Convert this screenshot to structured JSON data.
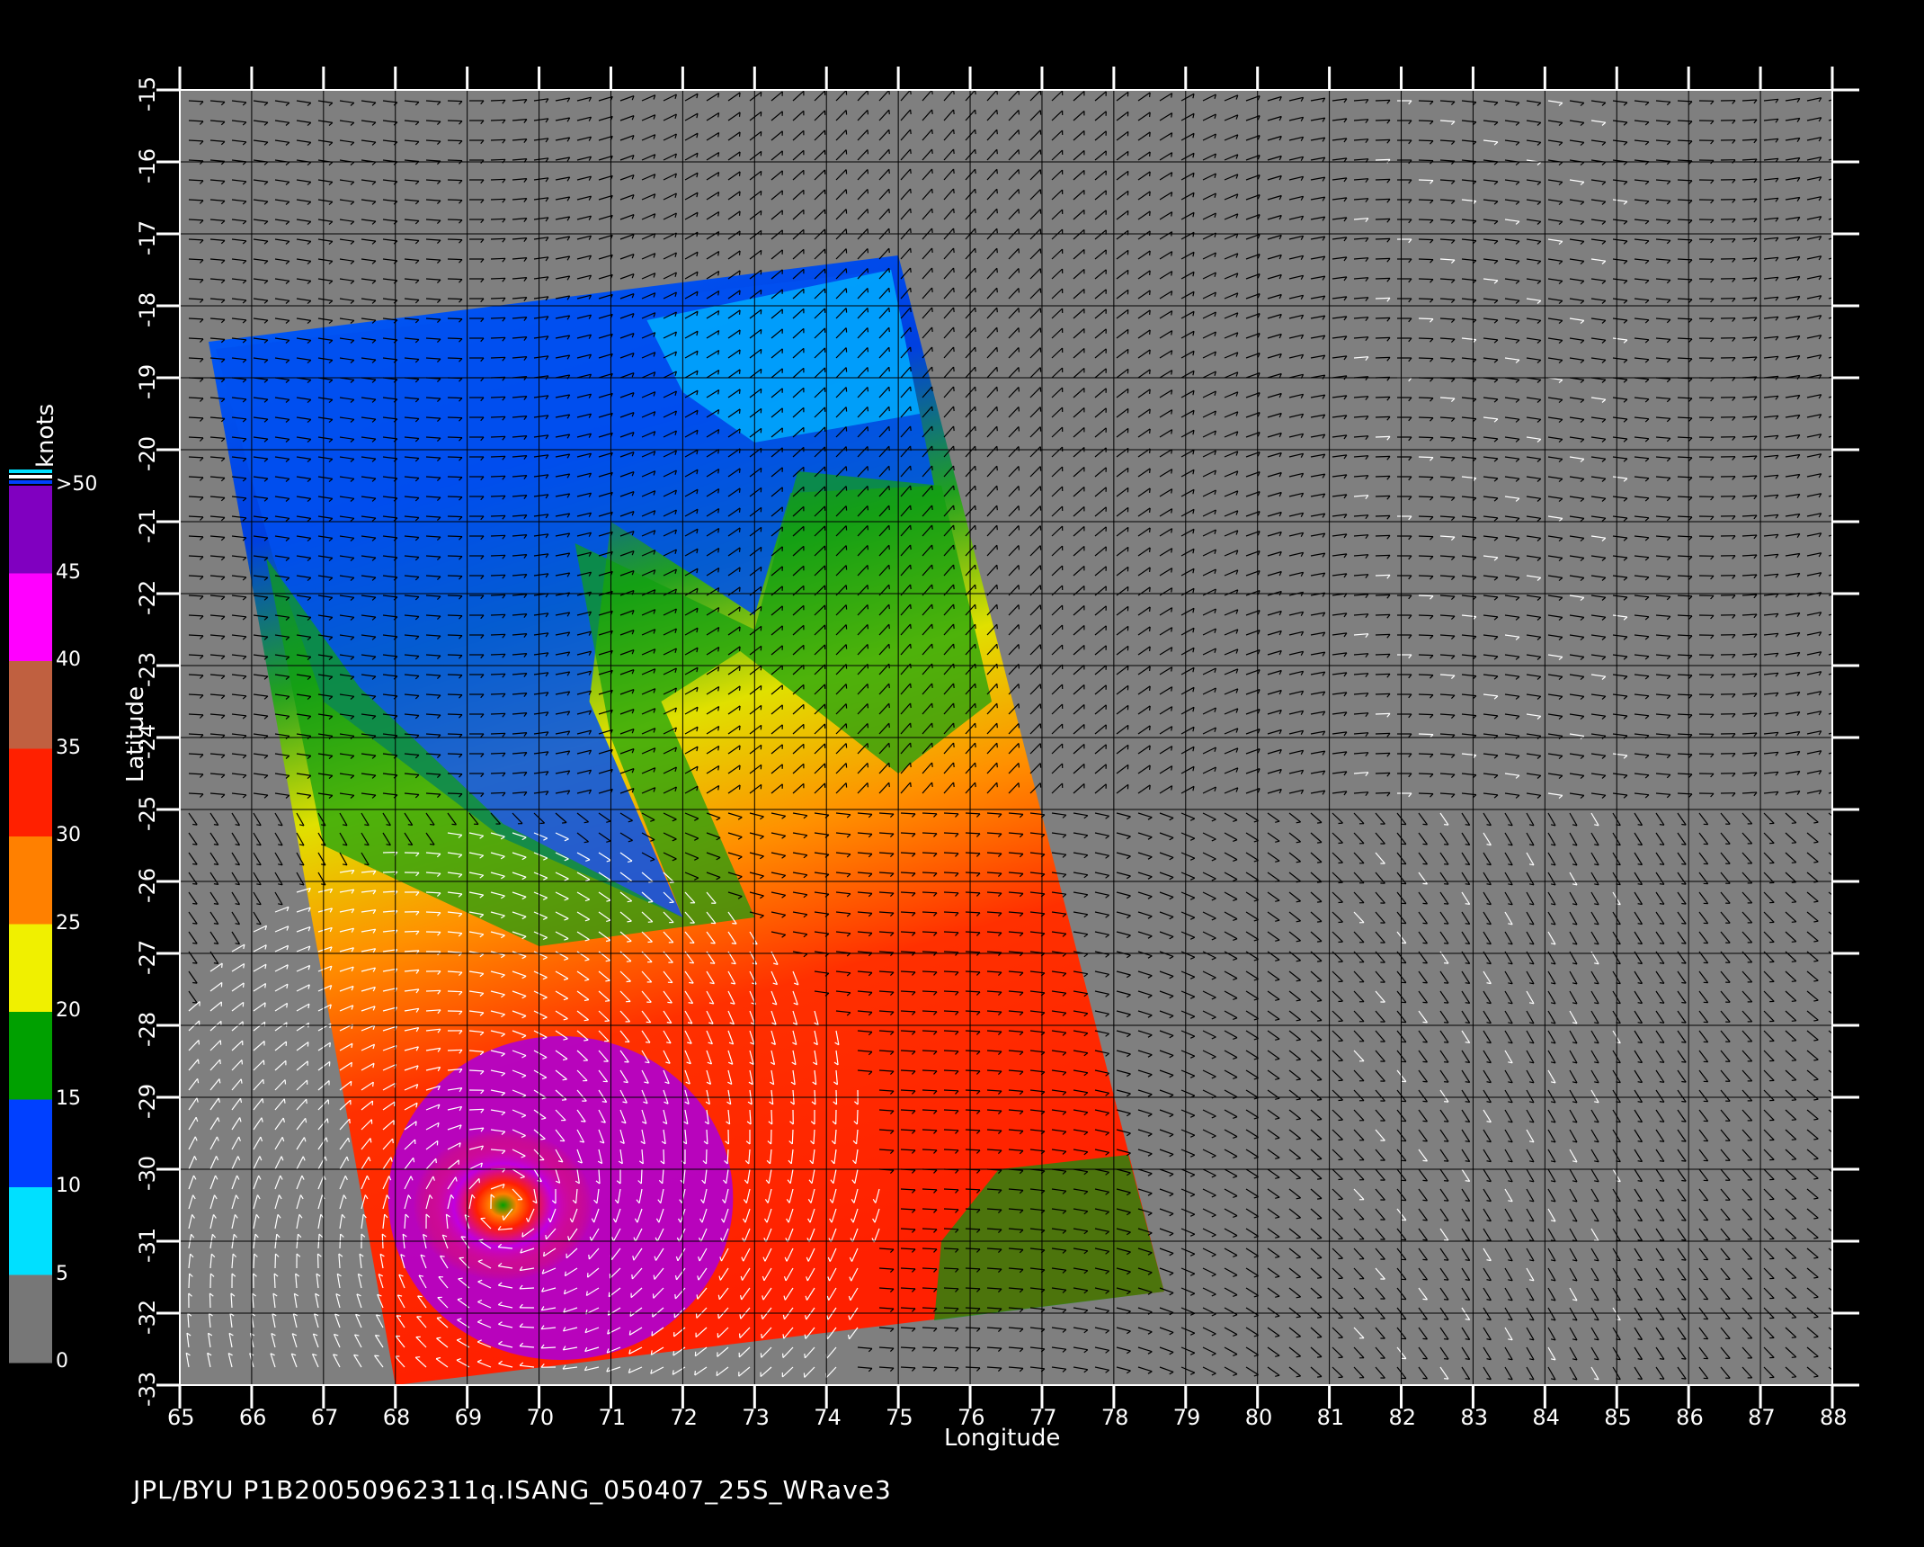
{
  "caption": "JPL/BYU  P1B20050962311q.ISANG_050407_25S_WRave3",
  "x_axis": {
    "title": "Longitude",
    "ticks": [
      "65",
      "66",
      "67",
      "68",
      "69",
      "70",
      "71",
      "72",
      "73",
      "74",
      "75",
      "76",
      "77",
      "78",
      "79",
      "80",
      "81",
      "82",
      "83",
      "84",
      "85",
      "86",
      "87",
      "88"
    ]
  },
  "y_axis": {
    "title": "Latitude",
    "ticks": [
      "-15",
      "-16",
      "-17",
      "-18",
      "-19",
      "-20",
      "-21",
      "-22",
      "-23",
      "-24",
      "-25",
      "-26",
      "-27",
      "-28",
      "-29",
      "-30",
      "-31",
      "-32",
      "-33"
    ]
  },
  "colorbar": {
    "title": "knots",
    "labels": [
      "0",
      "5",
      "10",
      "15",
      "20",
      "25",
      "30",
      "35",
      "40",
      "45",
      ">50"
    ],
    "colors": [
      "#777777",
      "#00e0ff",
      "#0040ff",
      "#00a000",
      "#f0f000",
      "#ff8000",
      "#ff2000",
      "#c06040",
      "#ff00ff",
      "#8000c0"
    ]
  },
  "map": {
    "lon_range": [
      65,
      88
    ],
    "lat_range": [
      -33,
      -15
    ],
    "background_color": "#7f7f7f",
    "grid": true,
    "vector_colors": [
      "#000000",
      "#ffffff"
    ],
    "swath_corners_lonlat": [
      [
        65.4,
        -18.5
      ],
      [
        75.0,
        -17.3
      ],
      [
        78.7,
        -31.7
      ],
      [
        68.0,
        -33.0
      ]
    ]
  }
}
